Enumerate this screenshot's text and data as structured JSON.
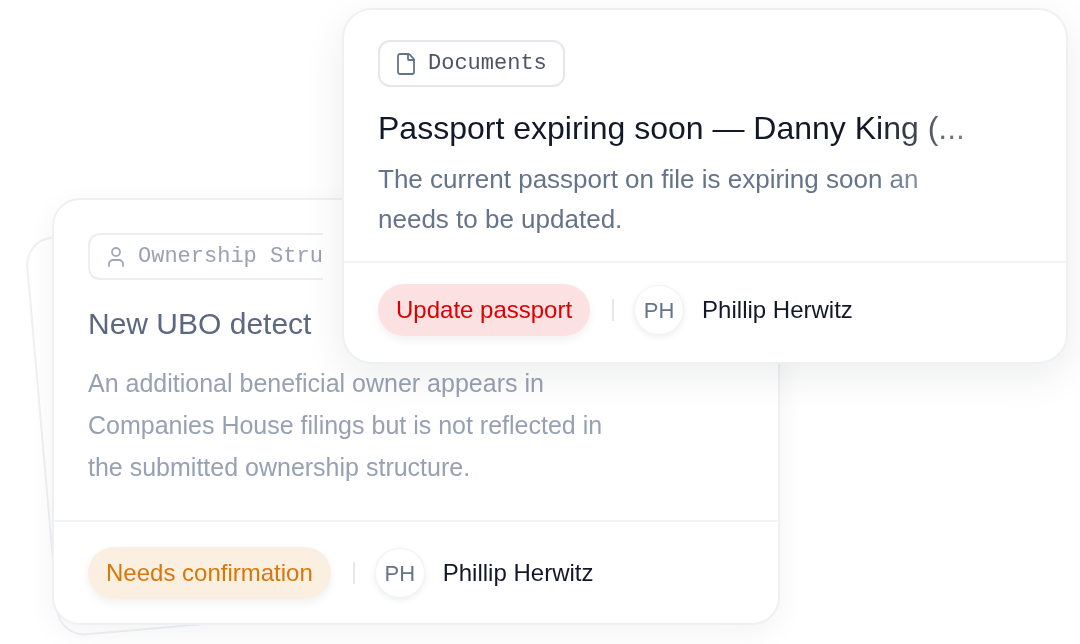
{
  "cards": [
    {
      "kind": "document",
      "category": "Documents",
      "title": "Passport expiring soon — Danny King (...",
      "description_lines": [
        "The current passport on file is expiring soon an",
        "needs to be updated."
      ],
      "action": {
        "label": "Update passport",
        "color": "#dc0000"
      },
      "assignee": {
        "initials": "PH",
        "name": "Phillip Herwitz"
      }
    },
    {
      "kind": "ownership",
      "category": "Ownership Stru",
      "title": "New UBO detect",
      "description_lines": [
        "An additional beneficial owner appears in",
        "Companies House filings but is not reflected in",
        "the submitted ownership structure."
      ],
      "action": {
        "label": "Needs confirmation",
        "color": "#d97706"
      },
      "assignee": {
        "initials": "PH",
        "name": "Phillip Herwitz"
      }
    }
  ]
}
